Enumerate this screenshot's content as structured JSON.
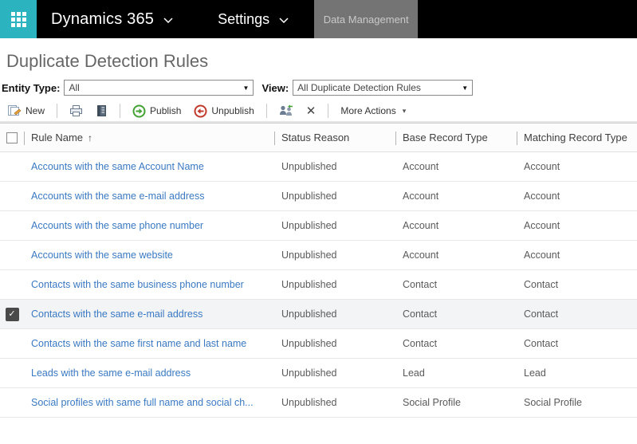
{
  "nav": {
    "brand": "Dynamics 365",
    "menu": "Settings",
    "active_area": "Data Management"
  },
  "page": {
    "title": "Duplicate Detection Rules"
  },
  "filters": {
    "entity_type_label": "Entity Type:",
    "entity_type_value": "All",
    "view_label": "View:",
    "view_value": "All Duplicate Detection Rules"
  },
  "toolbar": {
    "new_label": "New",
    "publish_label": "Publish",
    "unpublish_label": "Unpublish",
    "more_actions_label": "More Actions"
  },
  "grid": {
    "columns": [
      "Rule Name",
      "Status Reason",
      "Base Record Type",
      "Matching Record Type"
    ],
    "sort_column": "Rule Name",
    "sort_direction": "ascending",
    "sort_arrow": "↑",
    "rows": [
      {
        "rule_name": "Accounts with the same Account Name",
        "status_reason": "Unpublished",
        "base_record_type": "Account",
        "matching_record_type": "Account",
        "selected": false
      },
      {
        "rule_name": "Accounts with the same e-mail address",
        "status_reason": "Unpublished",
        "base_record_type": "Account",
        "matching_record_type": "Account",
        "selected": false
      },
      {
        "rule_name": "Accounts with the same phone number",
        "status_reason": "Unpublished",
        "base_record_type": "Account",
        "matching_record_type": "Account",
        "selected": false
      },
      {
        "rule_name": "Accounts with the same website",
        "status_reason": "Unpublished",
        "base_record_type": "Account",
        "matching_record_type": "Account",
        "selected": false
      },
      {
        "rule_name": "Contacts with the same business phone number",
        "status_reason": "Unpublished",
        "base_record_type": "Contact",
        "matching_record_type": "Contact",
        "selected": false
      },
      {
        "rule_name": "Contacts with the same e-mail address",
        "status_reason": "Unpublished",
        "base_record_type": "Contact",
        "matching_record_type": "Contact",
        "selected": true
      },
      {
        "rule_name": "Contacts with the same first name and last name",
        "status_reason": "Unpublished",
        "base_record_type": "Contact",
        "matching_record_type": "Contact",
        "selected": false
      },
      {
        "rule_name": "Leads with the same e-mail address",
        "status_reason": "Unpublished",
        "base_record_type": "Lead",
        "matching_record_type": "Lead",
        "selected": false
      },
      {
        "rule_name": "Social profiles with same full name and social ch...",
        "status_reason": "Unpublished",
        "base_record_type": "Social Profile",
        "matching_record_type": "Social Profile",
        "selected": false
      }
    ]
  },
  "colors": {
    "app_launcher_teal": "#2bb3c0",
    "nav_black": "#000000",
    "active_tab_gray": "#747474",
    "link_blue": "#3a79c2",
    "publish_green": "#44a234",
    "unpublish_red": "#c0392b"
  }
}
